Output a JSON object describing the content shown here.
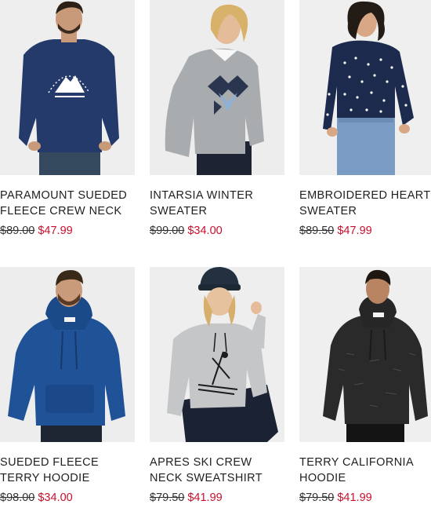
{
  "colors": {
    "sale": "#c8102e",
    "text": "#1f1f1f",
    "photo_bg": "#ececec"
  },
  "products": [
    {
      "name": "PARAMOUNT SUEDED FLEECE CREW NECK",
      "original_price": "$89.00",
      "sale_price": "$47.99",
      "image": "man-navy-paramount-crewneck"
    },
    {
      "name": "INTARSIA WINTER SWEATER",
      "original_price": "$99.00",
      "sale_price": "$34.00",
      "image": "woman-grey-intarsia-sweater"
    },
    {
      "name": "EMBROIDERED HEART SWEATER",
      "original_price": "$89.50",
      "sale_price": "$47.99",
      "image": "woman-navy-dotted-sweater"
    },
    {
      "name": "SUEDED FLEECE TERRY HOODIE",
      "original_price": "$98.00",
      "sale_price": "$34.00",
      "image": "man-blue-hoodie"
    },
    {
      "name": "APRES SKI CREW NECK SWEATSHIRT",
      "original_price": "$79.50",
      "sale_price": "$41.99",
      "image": "woman-grey-ski-sweatshirt"
    },
    {
      "name": "TERRY CALIFORNIA HOODIE",
      "original_price": "$79.50",
      "sale_price": "$41.99",
      "image": "man-black-hoodie"
    }
  ]
}
